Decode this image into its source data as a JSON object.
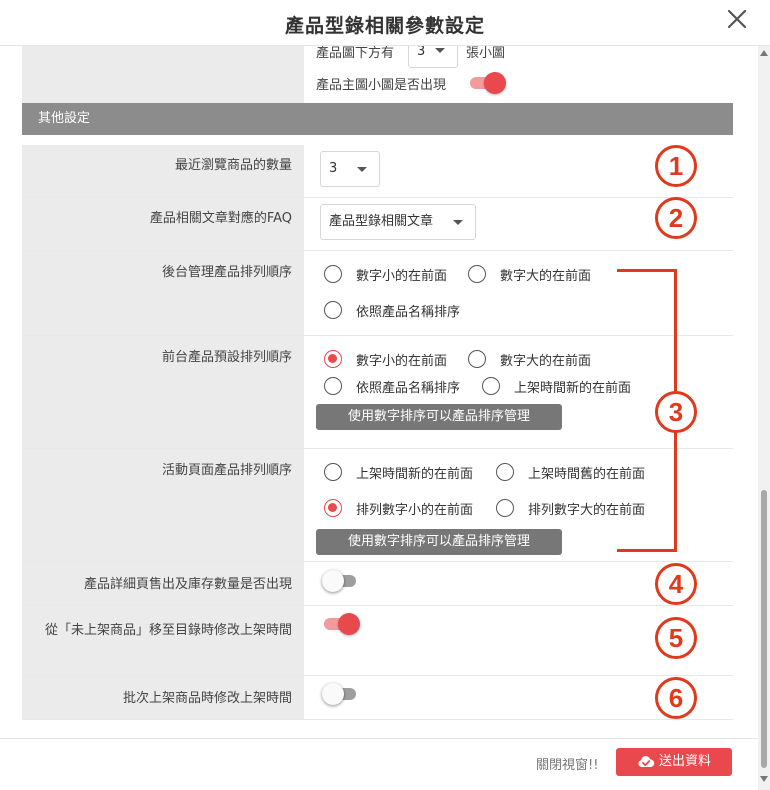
{
  "modal": {
    "title": "產品型錄相關參數設定",
    "close_icon": "close-icon"
  },
  "top_partial": {
    "thumb_count_label": "產品圖下方有",
    "thumb_count_value": "3",
    "thumb_count_suffix": "張小圖",
    "main_thumb_label": "產品主圖小圖是否出現",
    "main_thumb_enabled": true
  },
  "section": {
    "title": "其他設定"
  },
  "settings": {
    "recent_count": {
      "label": "最近瀏覽商品的數量",
      "value": "3"
    },
    "faq": {
      "label": "產品相關文章對應的FAQ",
      "value": "產品型錄相關文章"
    },
    "backend_sort": {
      "label": "後台管理產品排列順序",
      "options": [
        "數字小的在前面",
        "數字大的在前面",
        "依照產品名稱排序"
      ],
      "selected": -1
    },
    "frontend_sort": {
      "label": "前台產品預設排列順序",
      "options": [
        "數字小的在前面",
        "數字大的在前面",
        "依照產品名稱排序",
        "上架時間新的在前面"
      ],
      "selected": 0,
      "button": "使用數字排序可以產品排序管理"
    },
    "activity_sort": {
      "label": "活動頁面產品排列順序",
      "options": [
        "上架時間新的在前面",
        "上架時間舊的在前面",
        "排列數字小的在前面",
        "排列數字大的在前面"
      ],
      "selected": 2,
      "button": "使用數字排序可以產品排序管理"
    },
    "stock_display": {
      "label": "產品詳細頁售出及庫存數量是否出現",
      "enabled": false
    },
    "move_update_time": {
      "label": "從「未上架商品」移至目錄時修改上架時間",
      "enabled": true
    },
    "batch_update_time": {
      "label": "批次上架商品時修改上架時間",
      "enabled": false
    }
  },
  "annotations": [
    "1",
    "2",
    "3",
    "4",
    "5",
    "6"
  ],
  "footer": {
    "close_label": "關閉視窗!!",
    "submit_label": "送出資料"
  },
  "colors": {
    "accent": "#e9484d",
    "annotation": "#e03a1c",
    "section_bar": "#8c8c8c",
    "label_bg": "#ebebeb"
  }
}
